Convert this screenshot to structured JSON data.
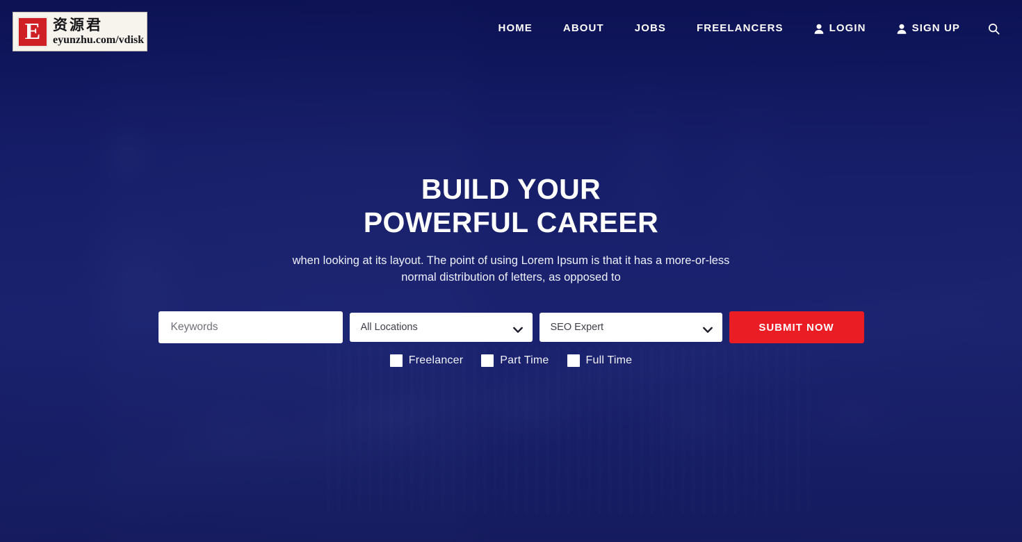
{
  "colors": {
    "brand_navy": "#141a5e",
    "overlay_navy": "#1b2370",
    "accent_red": "#ea1d25",
    "text_white": "#ffffff",
    "field_white": "#ffffff"
  },
  "logo": {
    "mark_letter": "E",
    "name_cn": "资源君",
    "url": "eyunzhu.com/vdisk"
  },
  "nav": {
    "items": [
      {
        "label": "HOME",
        "icon": null
      },
      {
        "label": "ABOUT",
        "icon": null
      },
      {
        "label": "JOBS",
        "icon": null
      },
      {
        "label": "FREELANCERS",
        "icon": null
      },
      {
        "label": "LOGIN",
        "icon": "user-icon"
      },
      {
        "label": "SIGN UP",
        "icon": "user-icon"
      }
    ],
    "search_icon": "search-icon"
  },
  "hero": {
    "title_line1": "BUILD YOUR",
    "title_line2": "POWERFUL CAREER",
    "subtitle": "when looking at its layout. The point of using Lorem Ipsum is that it has a more-or-less normal distribution of letters, as opposed to"
  },
  "search": {
    "keywords": {
      "placeholder": "Keywords",
      "value": ""
    },
    "location": {
      "selected": "All Locations",
      "options": [
        "All Locations"
      ],
      "chevron_icon": "chevron-down-icon"
    },
    "category": {
      "selected": "SEO Expert",
      "options": [
        "SEO Expert"
      ],
      "chevron_icon": "chevron-down-icon"
    },
    "submit_label": "SUBMIT NOW"
  },
  "job_types": [
    {
      "label": "Freelancer",
      "checked": false
    },
    {
      "label": "Part Time",
      "checked": false
    },
    {
      "label": "Full Time",
      "checked": false
    }
  ]
}
